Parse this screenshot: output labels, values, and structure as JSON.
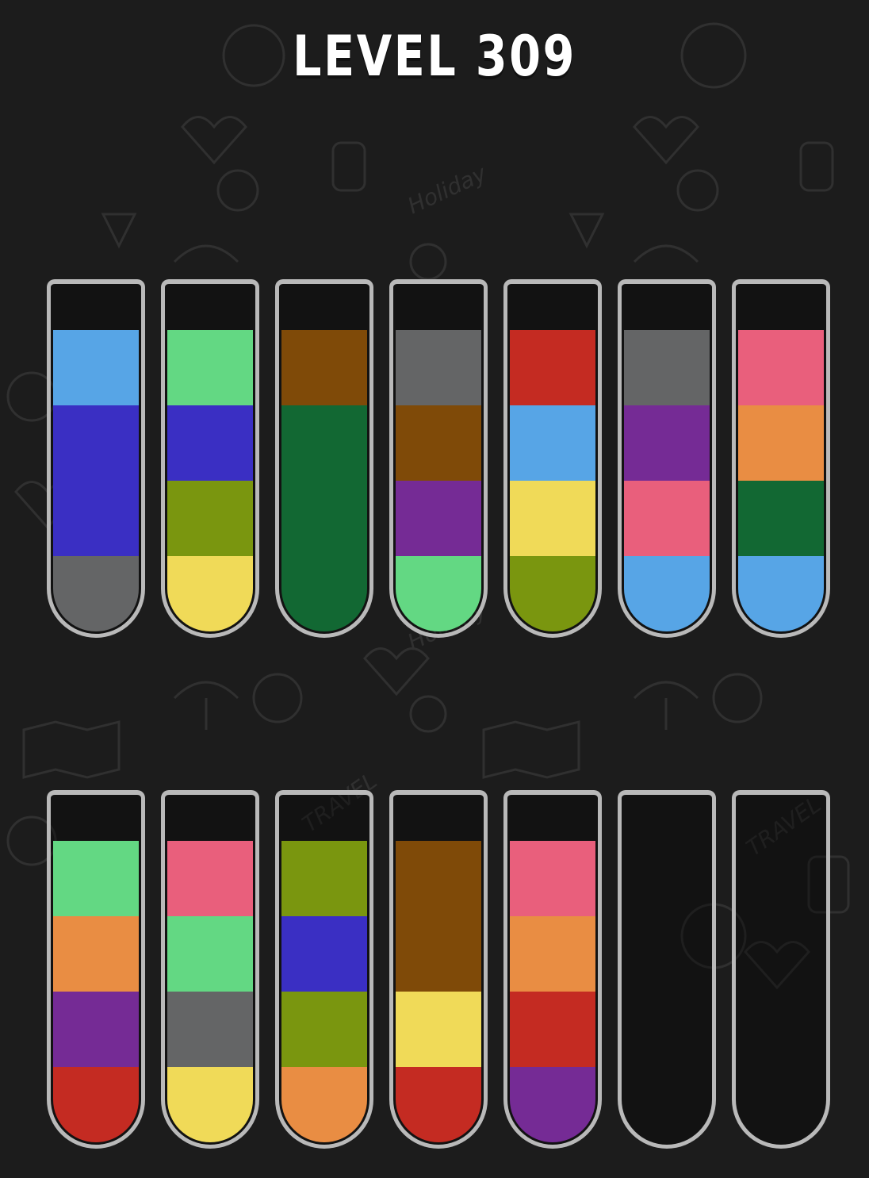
{
  "header": {
    "title": "LEVEL 309"
  },
  "palette": {
    "light_blue": "#57a5e6",
    "dark_blue": "#3a2fc3",
    "gray": "#646566",
    "light_green": "#63d883",
    "olive": "#7a960f",
    "yellow": "#f0da58",
    "brown": "#7f4a08",
    "dark_green": "#126833",
    "purple": "#752b95",
    "red": "#c42b22",
    "pink": "#e95f7c",
    "orange": "#e98d43"
  },
  "game": {
    "capacity": 4,
    "rows": [
      {
        "tubes": [
          {
            "layers_top_to_bottom": [
              "light_blue",
              "dark_blue",
              "dark_blue",
              "gray"
            ]
          },
          {
            "layers_top_to_bottom": [
              "light_green",
              "dark_blue",
              "olive",
              "yellow"
            ]
          },
          {
            "layers_top_to_bottom": [
              "brown",
              "dark_green",
              "dark_green",
              "dark_green"
            ]
          },
          {
            "layers_top_to_bottom": [
              "gray",
              "brown",
              "purple",
              "light_green"
            ]
          },
          {
            "layers_top_to_bottom": [
              "red",
              "light_blue",
              "yellow",
              "olive"
            ]
          },
          {
            "layers_top_to_bottom": [
              "gray",
              "purple",
              "pink",
              "light_blue"
            ]
          },
          {
            "layers_top_to_bottom": [
              "pink",
              "orange",
              "dark_green",
              "light_blue"
            ]
          }
        ]
      },
      {
        "tubes": [
          {
            "layers_top_to_bottom": [
              "light_green",
              "orange",
              "purple",
              "red"
            ]
          },
          {
            "layers_top_to_bottom": [
              "pink",
              "light_green",
              "gray",
              "yellow"
            ]
          },
          {
            "layers_top_to_bottom": [
              "olive",
              "dark_blue",
              "olive",
              "orange"
            ]
          },
          {
            "layers_top_to_bottom": [
              "brown",
              "brown",
              "yellow",
              "red"
            ]
          },
          {
            "layers_top_to_bottom": [
              "pink",
              "orange",
              "red",
              "purple"
            ]
          },
          {
            "layers_top_to_bottom": []
          },
          {
            "layers_top_to_bottom": []
          }
        ]
      }
    ]
  },
  "background": {
    "color": "#1c1c1c",
    "doodle_words": [
      "Holiday",
      "TRAVEL"
    ]
  }
}
